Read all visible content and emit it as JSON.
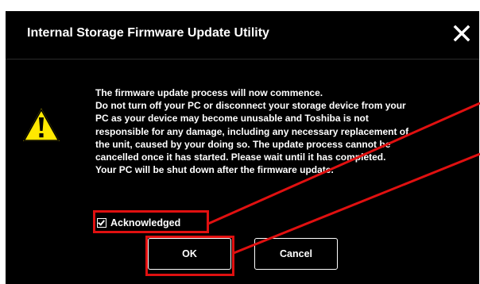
{
  "window": {
    "title": "Internal Storage Firmware Update Utility",
    "close_icon": "close-icon"
  },
  "warning": {
    "icon": "warning-triangle-icon",
    "icon_color": "#FFE800"
  },
  "message": {
    "lines": [
      "The firmware update process will now commence.",
      "Do not turn off your PC or disconnect your storage device from your",
      "PC as your device may become unusable and Toshiba is not",
      "responsible for any damage, including any necessary replacement of",
      "the unit, caused by your doing so. The update process cannot be",
      "cancelled once it has started. Please wait until it has completed.",
      "Your PC will be shut down after the firmware update."
    ]
  },
  "acknowledge": {
    "label": "Acknowledged",
    "checked": true
  },
  "buttons": {
    "ok_label": "OK",
    "cancel_label": "Cancel"
  },
  "colors": {
    "dialog_background": "#000000",
    "text": "#FFFFFF",
    "annotation": "#E01010"
  }
}
